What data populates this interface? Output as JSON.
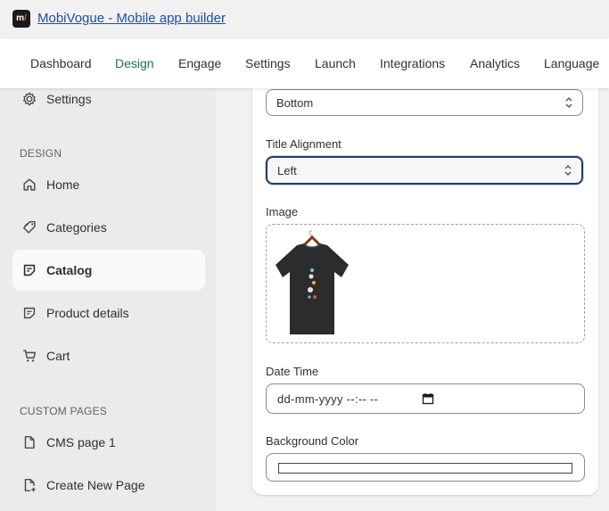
{
  "app": {
    "title": "MobiVogue - Mobile app builder",
    "logo_text": "m/"
  },
  "nav": {
    "tabs": [
      {
        "label": "Dashboard"
      },
      {
        "label": "Design",
        "active": true
      },
      {
        "label": "Engage"
      },
      {
        "label": "Settings"
      },
      {
        "label": "Launch"
      },
      {
        "label": "Integrations"
      },
      {
        "label": "Analytics"
      },
      {
        "label": "Language"
      }
    ]
  },
  "sidebar": {
    "settings_label": "Settings",
    "design_heading": "DESIGN",
    "items": [
      {
        "label": "Home",
        "icon": "home-icon"
      },
      {
        "label": "Categories",
        "icon": "tag-icon"
      },
      {
        "label": "Catalog",
        "icon": "catalog-icon",
        "active": true
      },
      {
        "label": "Product details",
        "icon": "product-details-icon"
      },
      {
        "label": "Cart",
        "icon": "cart-icon"
      }
    ],
    "custom_heading": "CUSTOM PAGES",
    "custom_items": [
      {
        "label": "CMS page 1",
        "icon": "page-icon"
      },
      {
        "label": "Create New Page",
        "icon": "new-page-icon"
      }
    ]
  },
  "form": {
    "position_value": "Bottom",
    "title_alignment_label": "Title Alignment",
    "title_alignment_value": "Left",
    "image_label": "Image",
    "datetime_label": "Date Time",
    "datetime_value": "dd-mm-yyyy --:-- --",
    "background_color_label": "Background Color",
    "background_color_value": "#ffffff"
  },
  "colors": {
    "accent": "#1b6f5a",
    "link": "#1f4fa3",
    "focus": "#1f3b73"
  }
}
